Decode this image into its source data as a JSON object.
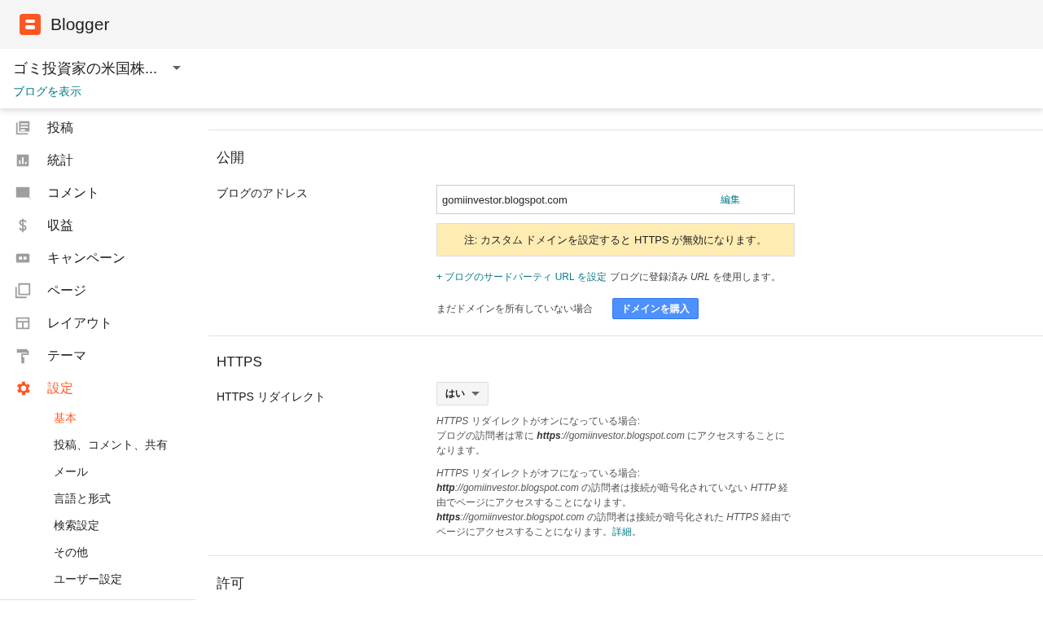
{
  "app": {
    "name": "Blogger"
  },
  "blog": {
    "title": "ゴミ投資家の米国株...",
    "view_link": "ブログを表示"
  },
  "sidebar": {
    "items": [
      {
        "label": "投稿",
        "selected": false
      },
      {
        "label": "統計",
        "selected": false
      },
      {
        "label": "コメント",
        "selected": false
      },
      {
        "label": "収益",
        "selected": false
      },
      {
        "label": "キャンペーン",
        "selected": false
      },
      {
        "label": "ページ",
        "selected": false
      },
      {
        "label": "レイアウト",
        "selected": false
      },
      {
        "label": "テーマ",
        "selected": false
      },
      {
        "label": "設定",
        "selected": true,
        "children": [
          {
            "label": "基本",
            "selected": true
          },
          {
            "label": "投稿、コメント、共有",
            "selected": false
          },
          {
            "label": "メール",
            "selected": false
          },
          {
            "label": "言語と形式",
            "selected": false
          },
          {
            "label": "検索設定",
            "selected": false
          },
          {
            "label": "その他",
            "selected": false
          },
          {
            "label": "ユーザー設定",
            "selected": false
          }
        ]
      }
    ]
  },
  "publishing": {
    "title": "公開",
    "address_label": "ブログのアドレス",
    "address_value": "gomiinvestor.blogspot.com",
    "edit_link": "編集",
    "note": "注: カスタム ドメインを設定すると HTTPS が無効になります。",
    "third_party_link": "+ ブログのサードパーティ URL を設定",
    "third_party_text": "ブログに登録済み *URL* を使用します。",
    "no_domain_text": "まだドメインを所有していない場合",
    "buy_domain_button": "ドメインを購入"
  },
  "https": {
    "title": "HTTPS",
    "redirect_label": "HTTPS リダイレクト",
    "redirect_value": "はい",
    "paragraphs": [
      {
        "lines": [
          {
            "text": "*HTTPS* リダイレクトがオンになっている場合:"
          },
          {
            "lead": "ブログの訪問者は常に ",
            "scheme": "https",
            "text": "*://gomiinvestor.blogspot.com* にアクセスすることになります。"
          }
        ]
      },
      {
        "lines": [
          {
            "text": "*HTTPS* リダイレクトがオフになっている場合:"
          },
          {
            "scheme": "http",
            "text": "*://gomiinvestor.blogspot.com* の訪問者は接続が暗号化されていない *HTTP* 経由でページにアクセスすることになります。"
          },
          {
            "scheme": "https",
            "text": "*://gomiinvestor.blogspot.com* の訪問者は接続が暗号化された *HTTPS* 経由でページにアクセスすることになります。"
          }
        ],
        "link": "詳細",
        "after_link": "。"
      }
    ]
  },
  "permissions": {
    "title": "許可"
  }
}
